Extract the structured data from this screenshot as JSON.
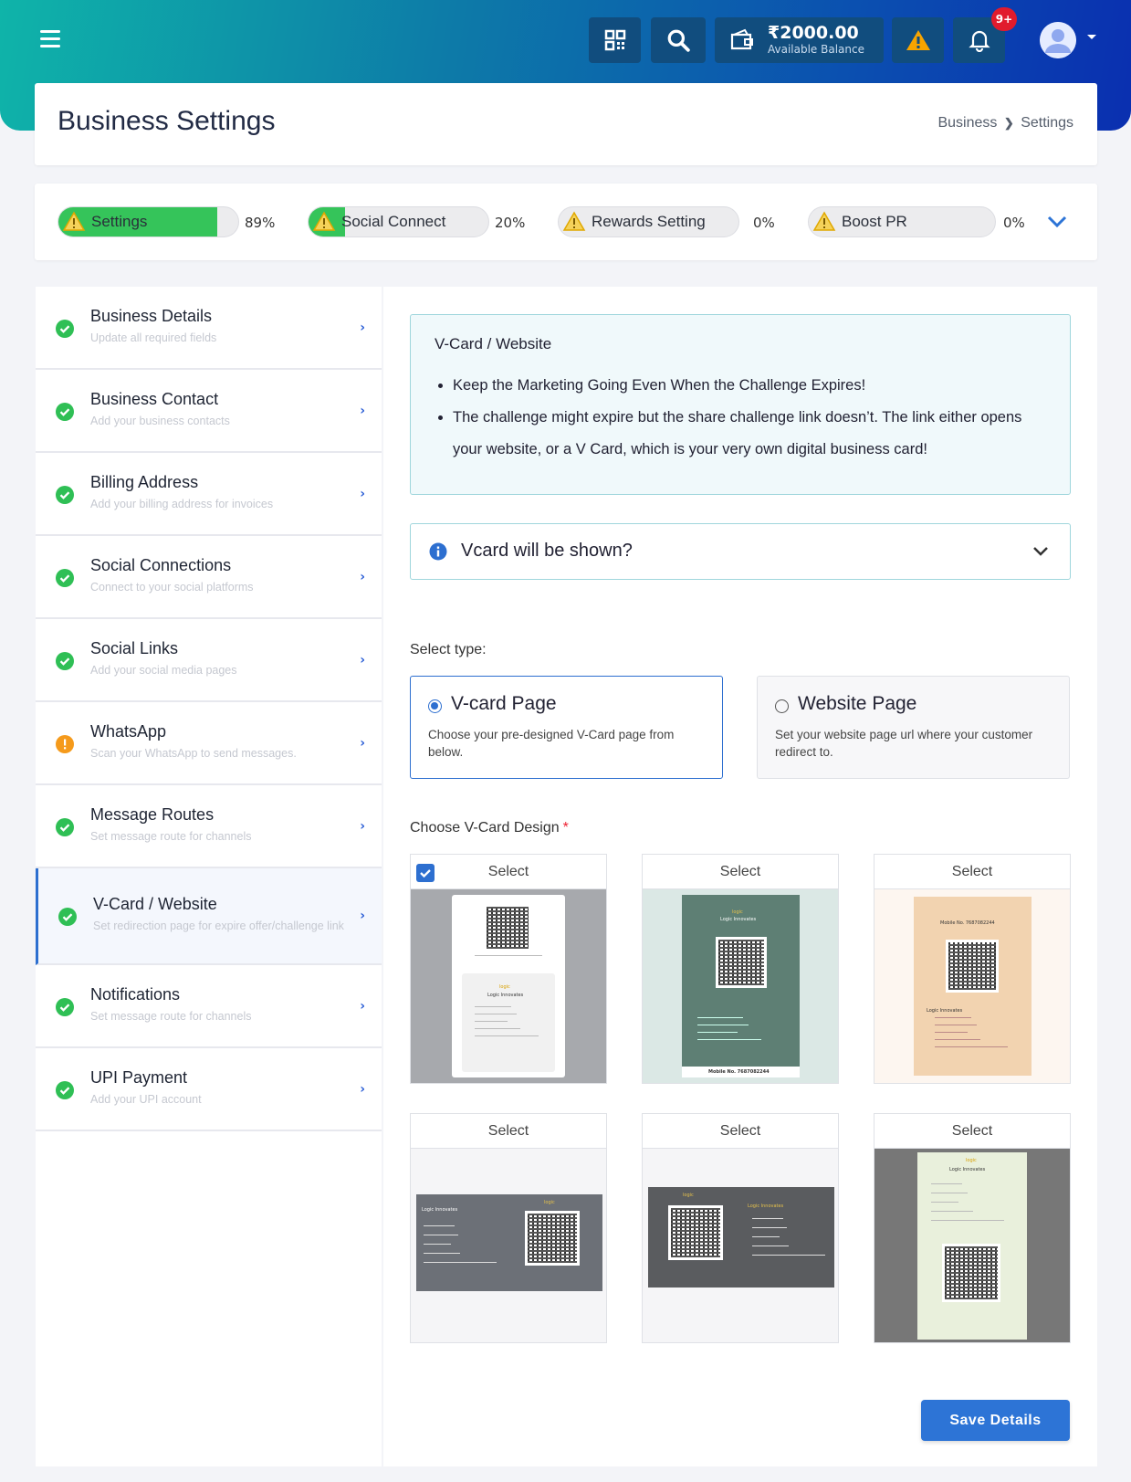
{
  "header": {
    "wallet_amount": "₹2000.00",
    "wallet_label": "Available Balance",
    "notif_badge": "9+"
  },
  "page": {
    "title": "Business Settings",
    "breadcrumb_parent": "Business",
    "breadcrumb_current": "Settings"
  },
  "progress": [
    {
      "label": "Settings",
      "percent": "89%",
      "value": 0.89
    },
    {
      "label": "Social Connect",
      "percent": "20%",
      "value": 0.2
    },
    {
      "label": "Rewards Setting",
      "percent": "0%",
      "value": 0
    },
    {
      "label": "Boost PR",
      "percent": "0%",
      "value": 0
    }
  ],
  "sidebar": {
    "items": [
      {
        "title": "Business Details",
        "subtitle": "Update all required fields",
        "status": "complete"
      },
      {
        "title": "Business Contact",
        "subtitle": "Add your business contacts",
        "status": "complete"
      },
      {
        "title": "Billing Address",
        "subtitle": "Add your billing address for invoices",
        "status": "complete"
      },
      {
        "title": "Social Connections",
        "subtitle": "Connect to your social platforms",
        "status": "complete"
      },
      {
        "title": "Social Links",
        "subtitle": "Add your social media pages",
        "status": "complete"
      },
      {
        "title": "WhatsApp",
        "subtitle": "Scan your WhatsApp to send messages.",
        "status": "warning"
      },
      {
        "title": "Message Routes",
        "subtitle": "Set message route for channels",
        "status": "complete"
      },
      {
        "title": "V-Card / Website",
        "subtitle": "Set redirection page for expire offer/challenge link",
        "status": "complete"
      },
      {
        "title": "Notifications",
        "subtitle": "Set message route for channels",
        "status": "complete"
      },
      {
        "title": "UPI Payment",
        "subtitle": "Add your UPI account",
        "status": "complete"
      }
    ]
  },
  "info": {
    "title": "V-Card / Website",
    "bullet1": "Keep the Marketing Going Even When the Challenge Expires!",
    "bullet2": "The challenge might expire but the share challenge link doesn’t. The link either opens your website, or a V Card, which is your very own digital business card!"
  },
  "accordion": {
    "question": "Vcard will be shown?"
  },
  "select_type": {
    "label": "Select type:",
    "options": [
      {
        "title": "V-card Page",
        "desc": "Choose your pre-designed V-Card page from below.",
        "selected": true
      },
      {
        "title": "Website Page",
        "desc": "Set your website page url where your customer redirect to.",
        "selected": false
      }
    ]
  },
  "designs": {
    "label": "Choose V-Card Design",
    "required_mark": "*",
    "select_label": "Select",
    "selected_index": 0,
    "card_texts": {
      "company": "Logic Innovates",
      "brand": "logic",
      "mobile": "Mobile No. 7687082244"
    }
  },
  "save_label": "Save Details"
}
